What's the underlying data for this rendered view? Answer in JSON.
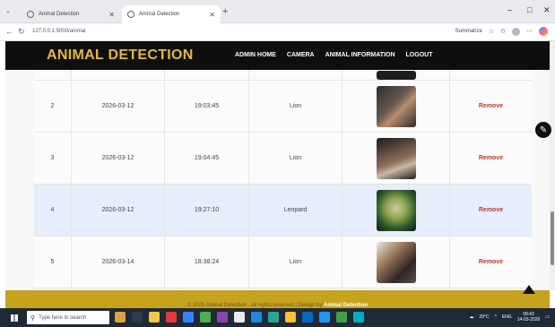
{
  "browser": {
    "tabs": [
      {
        "label": "Animal Detection",
        "active": false
      },
      {
        "label": "Animal Detection",
        "active": true
      }
    ],
    "url": "127.0.0.1:5000/animal",
    "summarize_label": "Summarize",
    "window_controls": [
      "–",
      "□",
      "✕"
    ]
  },
  "site": {
    "brand": "ANIMAL DETECTION",
    "nav": [
      "ADMIN HOME",
      "CAMERA",
      "ANIMAL INFORMATION",
      "LOGOUT"
    ]
  },
  "table": {
    "rows": [
      {
        "id": "2",
        "date": "2026-03-12",
        "time": "19:03:45",
        "animal": "Lion",
        "action": "Remove",
        "thumb": "t1"
      },
      {
        "id": "3",
        "date": "2026-03-12",
        "time": "19:04:45",
        "animal": "Lion",
        "action": "Remove",
        "thumb": "t2"
      },
      {
        "id": "4",
        "date": "2026-03-12",
        "time": "19:27:10",
        "animal": "Leopard",
        "action": "Remove",
        "thumb": "t3"
      },
      {
        "id": "5",
        "date": "2026-03-14",
        "time": "18:38:24",
        "animal": "Lion",
        "action": "Remove",
        "thumb": "t4"
      }
    ]
  },
  "footer": {
    "copyright": "© 2025 Animal Detection . All rights reserved | Design by",
    "designer": "Animal Detection"
  },
  "taskbar": {
    "search_placeholder": "Type here to search",
    "temperature": "29°C",
    "language": "ENG",
    "time": "09:43",
    "date": "14-03-2026"
  },
  "colors": {
    "brand": "#e5b83a",
    "header_bg": "#0e0e0e",
    "footer_bg": "#c7a21d",
    "remove": "#c0392b",
    "highlight_row": "#e6eefb"
  }
}
